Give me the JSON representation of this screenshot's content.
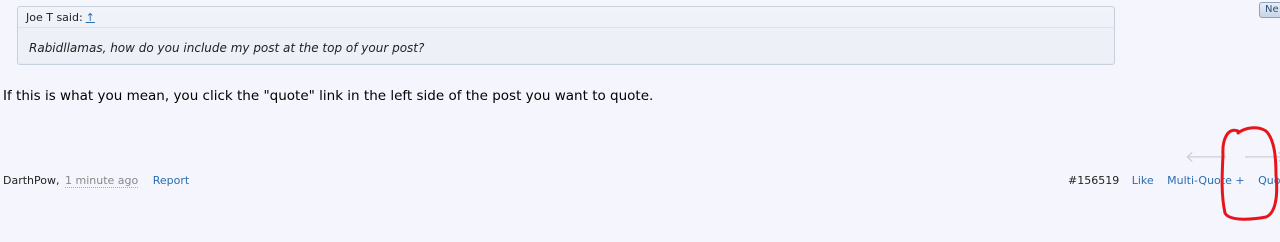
{
  "quote": {
    "author_said": "Joe T said:",
    "jump_icon": "↑",
    "text": "Rabidllamas, how do you include my post at the top of your post?"
  },
  "message": {
    "text": "If this is what you mean, you click the \"quote\" link in the left side of the post you want to quote."
  },
  "footer": {
    "author": "DarthPow,",
    "time": "1 minute ago",
    "report": "Report",
    "post_number": "#156519",
    "like": "Like",
    "multi_quote": "Multi-Quote +",
    "quote": "Quote"
  },
  "nav": {
    "prev_icon": "arrow-left-icon",
    "next_icon": "arrow-right-icon"
  },
  "top_button": {
    "label": "Ne"
  },
  "colors": {
    "background": "#f5f5fd",
    "link": "#2a6db0",
    "annotation": "#e8141c"
  }
}
